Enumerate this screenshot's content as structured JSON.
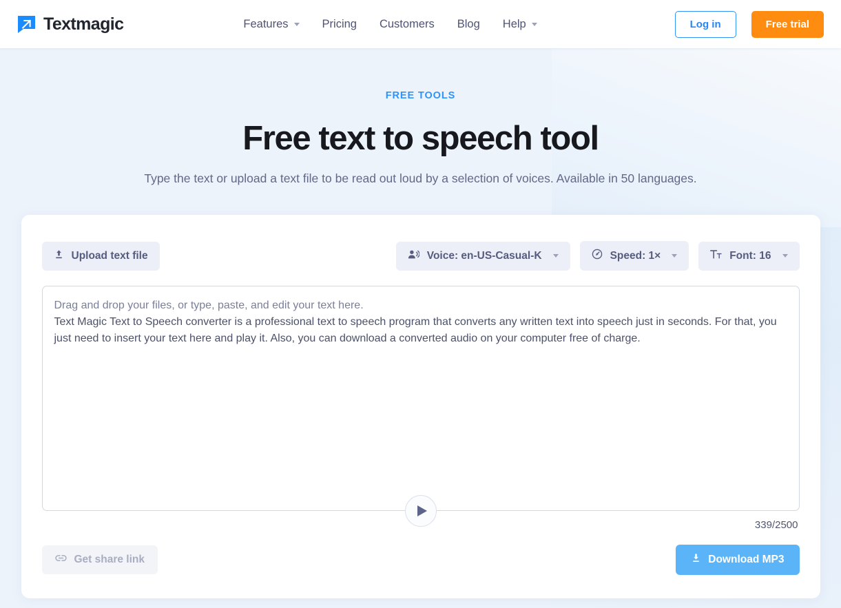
{
  "header": {
    "brand": {
      "name": "Textmagic",
      "logo_icon": "speech-bubble-arrow-icon",
      "logo_color": "#1a8cff"
    },
    "nav": [
      {
        "label": "Features",
        "has_dropdown": true
      },
      {
        "label": "Pricing",
        "has_dropdown": false
      },
      {
        "label": "Customers",
        "has_dropdown": false
      },
      {
        "label": "Blog",
        "has_dropdown": false
      },
      {
        "label": "Help",
        "has_dropdown": true
      }
    ],
    "login_label": "Log in",
    "trial_label": "Free trial",
    "login_color": "#2688f7",
    "trial_color": "#fd8c11"
  },
  "hero": {
    "eyebrow": "FREE TOOLS",
    "title": "Free text to speech tool",
    "subtitle": "Type the text or upload a text file to be read out loud by a selection of voices. Available in 50 languages.",
    "eyebrow_color": "#2e93fb"
  },
  "tool": {
    "upload": {
      "label": "Upload text file",
      "icon": "upload-icon"
    },
    "voice": {
      "label": "Voice: en-US-Casual-K",
      "icon": "voice-person-icon",
      "value": "en-US-Casual-K"
    },
    "speed": {
      "label": "Speed: 1×",
      "icon": "speedometer-icon",
      "value": "1×"
    },
    "font": {
      "label": "Font: 16",
      "icon": "font-size-icon",
      "value": "16"
    },
    "editor": {
      "placeholder": "Drag and drop your files, or type, paste, and edit your text here.",
      "hint_line": "Drag and drop your files, or type, paste, and edit your text here.",
      "value": "Text Magic Text to Speech converter is a professional text to speech program that converts any written text into speech just in seconds. For that, you just need to insert your text here and play it. Also, you can download a converted audio on your computer free of charge."
    },
    "play": {
      "icon": "play-icon",
      "label": "Play"
    },
    "counter": "339/2500",
    "char_count": 339,
    "char_limit": 2500,
    "share": {
      "label": "Get share link",
      "icon": "link-icon",
      "disabled": true
    },
    "download": {
      "label": "Download MP3",
      "icon": "download-icon",
      "color": "#5ab4f7"
    }
  }
}
